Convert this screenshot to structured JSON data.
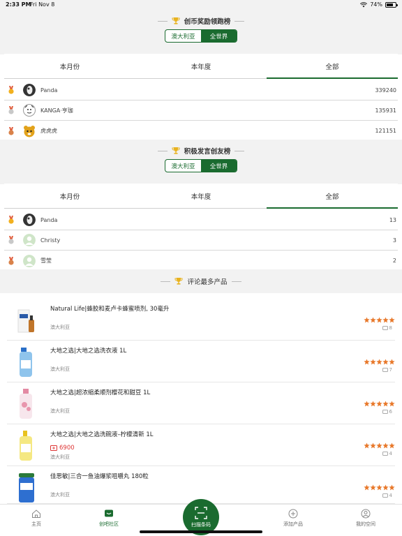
{
  "status": {
    "time": "2:33 PM",
    "date": "Fri Nov 8",
    "battery": "74%",
    "battery_level": 0.74
  },
  "colors": {
    "brand_green": "#1a6b2f",
    "star_orange": "#e8782a",
    "price_red": "#dd3333"
  },
  "coin_board": {
    "title": "创币奖励领跑榜",
    "region_options": [
      "澳大利亚",
      "全世界"
    ],
    "region_selected": "全世界",
    "tabs": [
      "本月份",
      "本年度",
      "全部"
    ],
    "tab_selected": "全部",
    "rows": [
      {
        "medal": "gold-medal-icon",
        "name": "Panda",
        "score": "339240"
      },
      {
        "medal": "silver-medal-icon",
        "name": "KANGA·亨珈",
        "score": "135931"
      },
      {
        "medal": "bronze-medal-icon",
        "name": "虎虎虎",
        "score": "121151"
      }
    ]
  },
  "post_board": {
    "title": "积极发言创友榜",
    "region_options": [
      "澳大利亚",
      "全世界"
    ],
    "region_selected": "全世界",
    "tabs": [
      "本月份",
      "本年度",
      "全部"
    ],
    "tab_selected": "全部",
    "rows": [
      {
        "medal": "gold-medal-icon",
        "name": "Panda",
        "score": "13"
      },
      {
        "medal": "silver-medal-icon",
        "name": "Christy",
        "score": "3"
      },
      {
        "medal": "bronze-medal-icon",
        "name": "雪莹",
        "score": "2"
      }
    ]
  },
  "products_section": {
    "title": "评论最多产品",
    "items": [
      {
        "name": "Natural Life|蜂胶和麦卢卡蜂蜜喷剂, 30毫升",
        "origin": "澳大利亚",
        "price": "",
        "rating": 5,
        "comments": "8"
      },
      {
        "name": "大地之选|大地之选洗衣液 1L",
        "origin": "澳大利亚",
        "price": "",
        "rating": 5,
        "comments": "7"
      },
      {
        "name": "大地之选|超浓缩柔顺剂樱花和甜豆 1L",
        "origin": "澳大利亚",
        "price": "",
        "rating": 5,
        "comments": "6"
      },
      {
        "name": "大地之选|大地之选洗碗液–柠檬清新 1L",
        "origin": "澳大利亚",
        "price": "6900",
        "rating": 5,
        "comments": "4"
      },
      {
        "name": "佳思敏|三合一鱼油爆浆咀嚼丸 180粒",
        "origin": "澳大利亚",
        "price": "",
        "rating": 5,
        "comments": "4"
      }
    ]
  },
  "nav": {
    "home": "主页",
    "community": "创吧社区",
    "scan": "扫描条码",
    "add_product": "添加产品",
    "my_space": "我的空间"
  }
}
